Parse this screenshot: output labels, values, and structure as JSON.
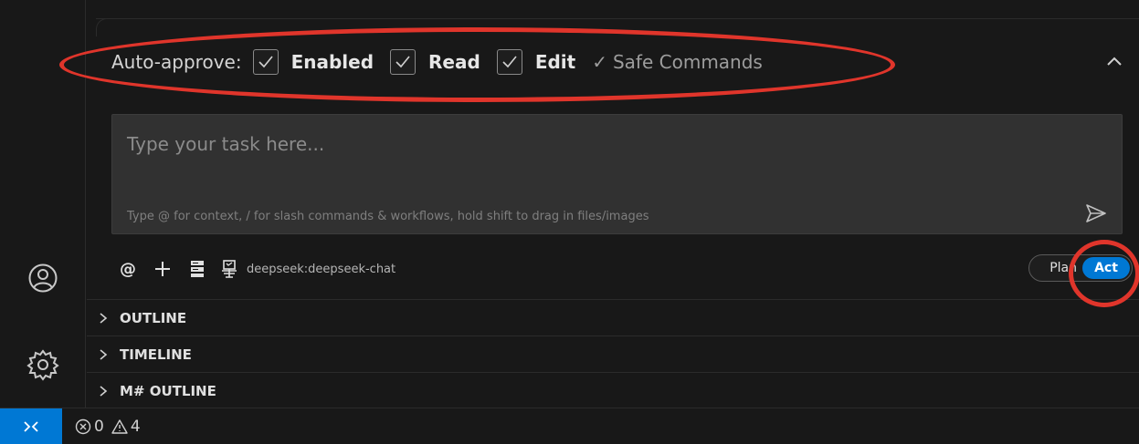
{
  "auto_approve": {
    "label": "Auto-approve:",
    "items": [
      {
        "label": "Enabled",
        "checked": true
      },
      {
        "label": "Read",
        "checked": true
      },
      {
        "label": "Edit",
        "checked": true
      }
    ],
    "safe_commands": "Safe Commands",
    "safe_tick": "✓"
  },
  "input": {
    "placeholder": "Type your task here...",
    "hint": "Type @ for context, / for slash commands & workflows, hold shift to drag in files/images"
  },
  "toolbar": {
    "at_label": "@",
    "plus_label": "+",
    "model": "deepseek:deepseek-chat"
  },
  "mode": {
    "plan": "Plan",
    "act": "Act",
    "active": "Act"
  },
  "sections": [
    {
      "title": "OUTLINE"
    },
    {
      "title": "TIMELINE"
    },
    {
      "title": "M# OUTLINE"
    }
  ],
  "status": {
    "errors": "0",
    "warnings": "4"
  },
  "colors": {
    "accent": "#0078d4",
    "annotation": "#e0352b",
    "background": "#181818"
  }
}
